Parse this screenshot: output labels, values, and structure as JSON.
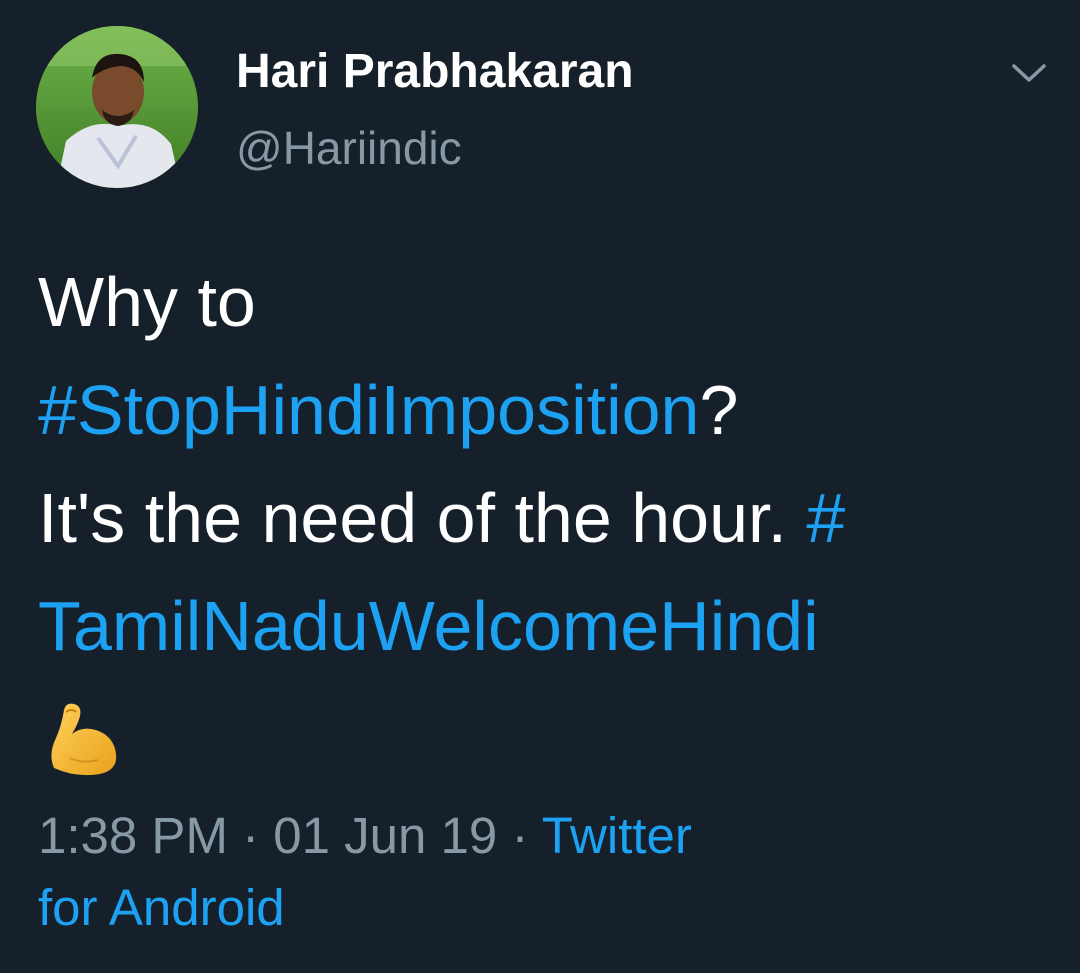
{
  "tweet": {
    "author": {
      "display_name": "Hari Prabhakaran",
      "handle": "@Hariindic"
    },
    "text": {
      "line1": "Why to",
      "hashtag1": "#StopHindiImposition",
      "after_hashtag1": "?",
      "line3_text": "It's the need of the hour. ",
      "hashtag2_part1": "#",
      "hashtag2_part2": "TamilNaduWelcomeHindi",
      "emoji": "flexed-biceps-emoji"
    },
    "meta": {
      "time": "1:38 PM",
      "separator": " · ",
      "date": "01 Jun 19",
      "source_part1": "Twitter",
      "source_part2": "for Android"
    },
    "icons": {
      "menu": "chevron-down-icon"
    }
  },
  "colors": {
    "background": "#16202b",
    "link": "#1da1f2",
    "secondary": "#8899a6",
    "primary": "#ffffff"
  }
}
